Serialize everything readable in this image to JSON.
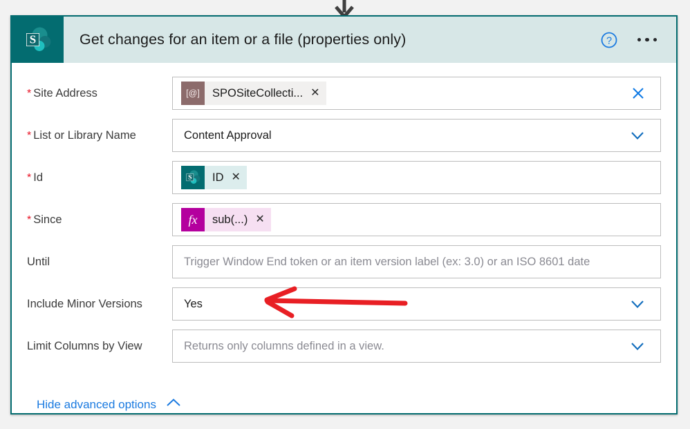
{
  "card": {
    "app_icon": "sharepoint-icon",
    "title": "Get changes for an item or a file (properties only)",
    "help_label": "?",
    "menu_label": "More commands"
  },
  "fields": [
    {
      "label": "Site Address",
      "required": true,
      "type": "token",
      "token": {
        "badge": "[@]",
        "text": "SPOSiteCollecti...",
        "remove": "✕",
        "style": "sposite"
      },
      "right_icon": "clear-icon"
    },
    {
      "label": "List or Library Name",
      "required": true,
      "type": "value",
      "value": "Content Approval",
      "right_icon": "chevron-down-icon"
    },
    {
      "label": "Id",
      "required": true,
      "type": "token",
      "token": {
        "badge": "sharepoint-icon",
        "text": "ID",
        "remove": "✕",
        "style": "sp"
      },
      "right_icon": "none"
    },
    {
      "label": "Since",
      "required": true,
      "type": "token",
      "token": {
        "badge": "fx",
        "text": "sub(...)",
        "remove": "✕",
        "style": "fx"
      },
      "right_icon": "none"
    },
    {
      "label": "Until",
      "required": false,
      "type": "placeholder",
      "placeholder": "Trigger Window End token or an item version label (ex: 3.0) or an ISO 8601 date",
      "right_icon": "none"
    },
    {
      "label": "Include Minor Versions",
      "required": false,
      "type": "value",
      "value": "Yes",
      "right_icon": "chevron-down-icon"
    },
    {
      "label": "Limit Columns by View",
      "required": false,
      "type": "placeholder",
      "placeholder": "Returns only columns defined in a view.",
      "right_icon": "chevron-down-icon"
    }
  ],
  "footer": {
    "advanced_label": "Hide advanced options",
    "advanced_chevron": "chevron-up-icon"
  },
  "annotation": {
    "type": "arrow",
    "color": "#e81f24",
    "points_to": "Include Minor Versions value"
  },
  "colors": {
    "brand_teal": "#036c70",
    "header_bg": "#d7e7e7",
    "link_blue": "#1a7ae0",
    "required_red": "#e81123",
    "annotation_red": "#e81f24"
  }
}
